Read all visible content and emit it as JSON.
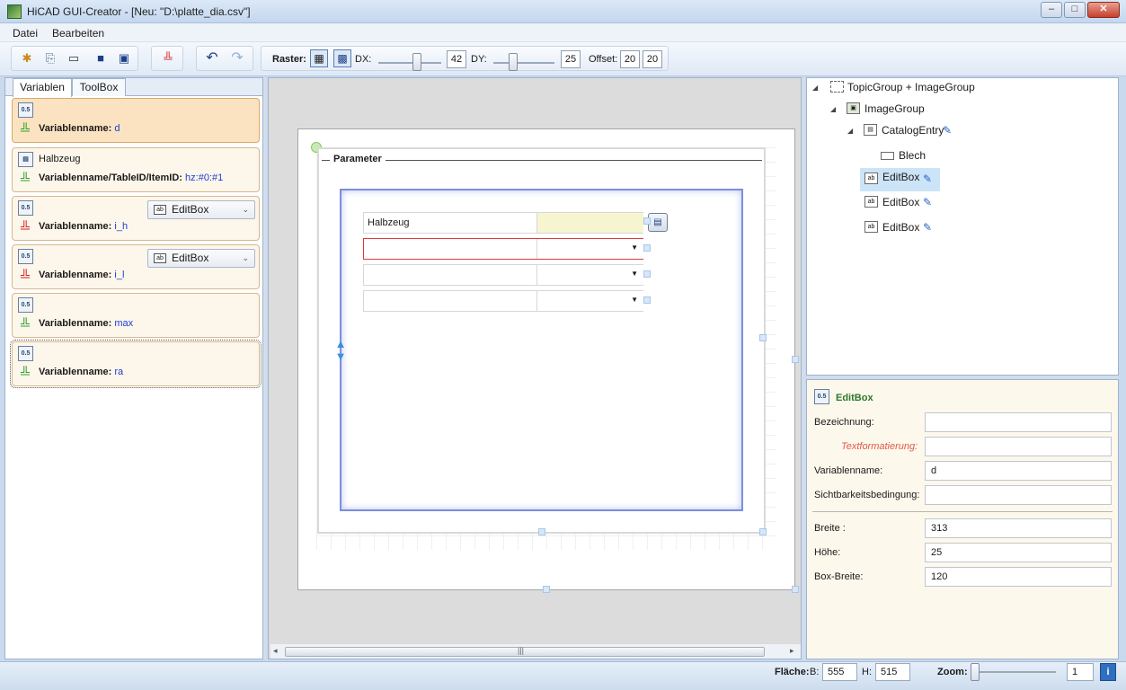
{
  "window": {
    "title": "HiCAD GUI-Creator - [Neu: \"D:\\platte_dia.csv\"]"
  },
  "menu": [
    "Datei",
    "Bearbeiten"
  ],
  "toolbar": {
    "raster_label": "Raster:",
    "dx_label": "DX:",
    "dx_value": "42",
    "dy_label": "DY:",
    "dy_value": "25",
    "offset_label": "Offset:",
    "offset_x": "20",
    "offset_y": "20"
  },
  "left_tabs": [
    "Variablen",
    "ToolBox"
  ],
  "variables": [
    {
      "label": "Variablenname:",
      "value": "d",
      "plug": "green",
      "selected": true
    },
    {
      "title": "Halbzeug",
      "label": "Variablenname/TableID/ItemID:",
      "value": "hz:#0:#1",
      "plug": "green"
    },
    {
      "label": "Variablenname:",
      "value": "i_h",
      "plug": "red",
      "dropdown": "EditBox"
    },
    {
      "label": "Variablenname:",
      "value": "i_l",
      "plug": "red",
      "dropdown": "EditBox"
    },
    {
      "label": "Variablenname:",
      "value": "max",
      "plug": "green"
    },
    {
      "label": "Variablenname:",
      "value": "ra",
      "plug": "green",
      "focused": true
    }
  ],
  "designer": {
    "group_title": "Parameter",
    "rows": [
      {
        "label": "Halbzeug",
        "type": "catalog"
      },
      {
        "label": "",
        "type": "dropdown"
      },
      {
        "label": "",
        "type": "dropdown"
      },
      {
        "label": "",
        "type": "dropdown"
      }
    ]
  },
  "tree": [
    {
      "label": "TopicGroup + ImageGroup"
    },
    {
      "label": "ImageGroup"
    },
    {
      "label": "CatalogEntry"
    },
    {
      "label": "Blech"
    },
    {
      "label": "EditBox"
    },
    {
      "label": "EditBox"
    },
    {
      "label": "EditBox"
    }
  ],
  "properties": {
    "header": "EditBox",
    "bezeichnung_label": "Bezeichnung:",
    "bezeichnung": "",
    "textformat_label": "Textformatierung:",
    "textformat": "",
    "varname_label": "Variablenname:",
    "varname": "d",
    "sicht_label": "Sichtbarkeitsbedingung:",
    "sicht": "",
    "breite_label": "Breite :",
    "breite": "313",
    "hoehe_label": "Höhe:",
    "hoehe": "25",
    "boxbreite_label": "Box-Breite:",
    "boxbreite": "120"
  },
  "status": {
    "flaeche_label": "Fläche:",
    "b_label": "B:",
    "b_value": "555",
    "h_label": "H:",
    "h_value": "515",
    "zoom_label": "Zoom:",
    "zoom_value": "1"
  }
}
